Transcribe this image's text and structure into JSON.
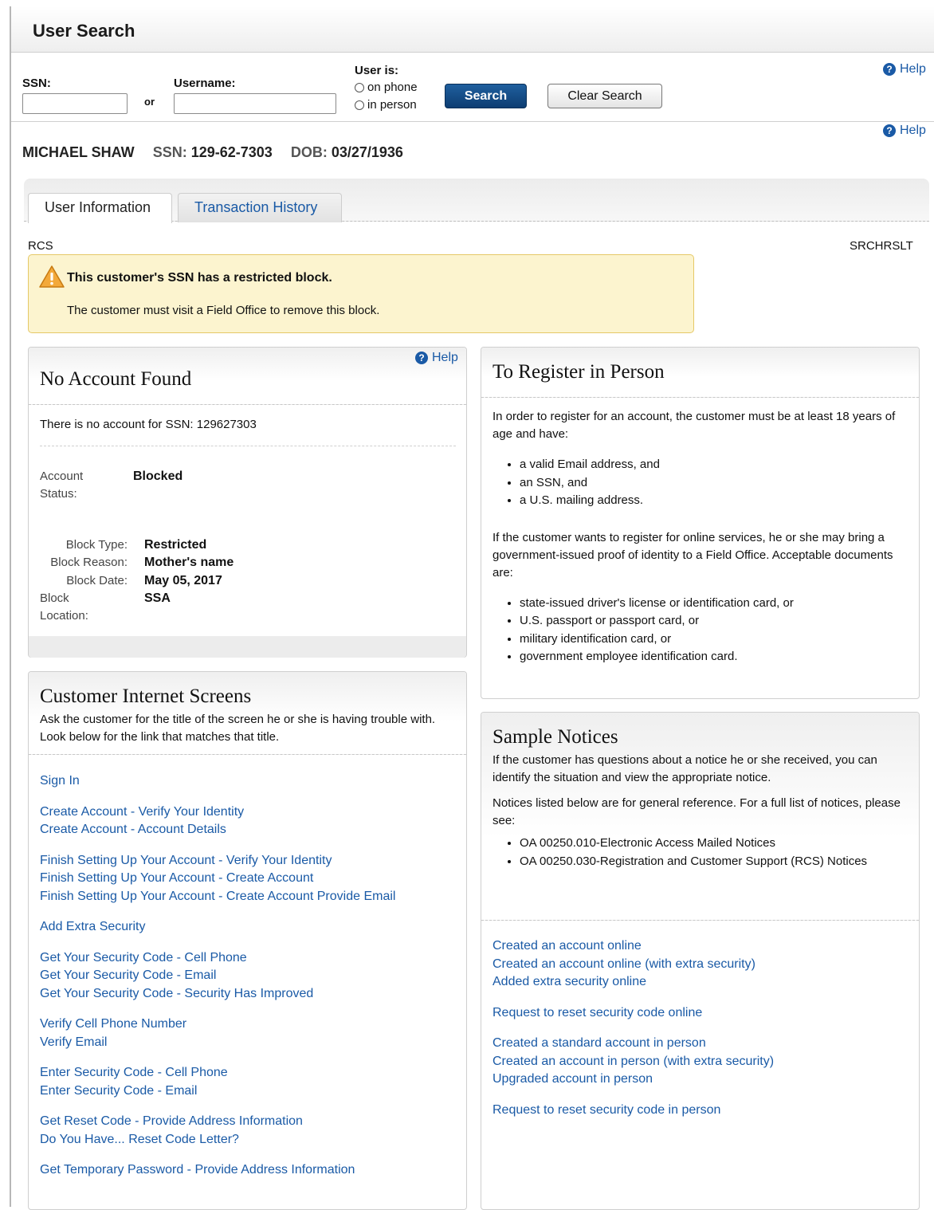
{
  "window": {
    "title": "User Search"
  },
  "search": {
    "ssn_label": "SSN:",
    "or_label": "or",
    "username_label": "Username:",
    "user_is_label": "User is:",
    "options": [
      "on phone",
      "in person"
    ],
    "search_button": "Search",
    "clear_button": "Clear Search",
    "help": "Help",
    "ssn_value": "",
    "username_value": ""
  },
  "person": {
    "name": "MICHAEL SHAW",
    "ssn_label": "SSN:",
    "ssn": "129-62-7303",
    "dob_label": "DOB:",
    "dob": "03/27/1936",
    "help": "Help"
  },
  "tabs": [
    {
      "label": "User Information",
      "active": true
    },
    {
      "label": "Transaction History",
      "active": false
    }
  ],
  "context": {
    "left": "RCS",
    "right": "SRCHRSLT"
  },
  "alert": {
    "title": "This customer's SSN has a restricted block.",
    "message": "The customer must visit a Field Office to remove this block."
  },
  "no_account": {
    "title": "No Account Found",
    "help": "Help",
    "message": "There is no account for SSN: 129627303",
    "account_status_label_1": "Account",
    "account_status_label_2": "Status:",
    "account_status": "Blocked",
    "block_type_label": "Block Type:",
    "block_type": "Restricted",
    "block_reason_label": "Block Reason:",
    "block_reason": "Mother's name",
    "block_date_label": "Block Date:",
    "block_date": "May 05, 2017",
    "block_location_label_1": "Block",
    "block_location_label_2": "Location:",
    "block_location": "SSA"
  },
  "register": {
    "title": "To Register in Person",
    "intro": "In order to register for an account, the customer must be at least 18 years of age and have:",
    "requirements": [
      "a valid Email address, and",
      "an SSN, and",
      "a U.S. mailing address."
    ],
    "online_text": "If the customer wants to register for online services, he or she may bring a government-issued proof of identity to a Field Office. Acceptable documents are:",
    "documents": [
      "state-issued driver's license or identification card, or",
      "U.S. passport or passport card, or",
      "military identification card, or",
      "government employee identification card."
    ]
  },
  "internet_screens": {
    "title": "Customer Internet Screens",
    "intro": "Ask the customer for the title of the screen he or she is having trouble with. Look below for the link that matches that title.",
    "groups": [
      [
        "Sign In"
      ],
      [
        "Create Account - Verify Your Identity",
        "Create Account - Account Details"
      ],
      [
        "Finish Setting Up Your Account - Verify Your Identity",
        "Finish Setting Up Your Account - Create Account",
        "Finish Setting Up Your Account - Create Account Provide Email"
      ],
      [
        "Add Extra Security"
      ],
      [
        "Get Your Security Code - Cell Phone",
        "Get Your Security Code - Email",
        "Get Your Security Code - Security Has Improved"
      ],
      [
        "Verify Cell Phone Number",
        "Verify Email"
      ],
      [
        "Enter Security Code - Cell Phone",
        "Enter Security Code - Email"
      ],
      [
        "Get Reset Code - Provide Address Information",
        "Do You Have... Reset Code Letter?"
      ],
      [
        "Get Temporary Password - Provide Address Information"
      ]
    ]
  },
  "notices": {
    "title": "Sample Notices",
    "intro": "If the customer has questions about a notice he or she received, you can identify the situation and view the appropriate notice.",
    "reference": "Notices listed below are for general reference. For a full list of notices, please see:",
    "refs": [
      "OA 00250.010-Electronic Access Mailed Notices",
      "OA 00250.030-Registration and Customer Support (RCS) Notices"
    ],
    "groups": [
      [
        "Created an account online",
        "Created an account online (with extra security)",
        "Added extra security online"
      ],
      [
        "Request to reset security code online"
      ],
      [
        "Created a standard account in person",
        "Created an account in person (with extra security)",
        "Upgraded account in person"
      ],
      [
        "Request to reset security code in person"
      ]
    ]
  },
  "colors": {
    "link": "#1a5aa6",
    "primary_button": "#0d3d72",
    "alert_bg": "#fcf4cf",
    "alert_border": "#e5c867"
  }
}
